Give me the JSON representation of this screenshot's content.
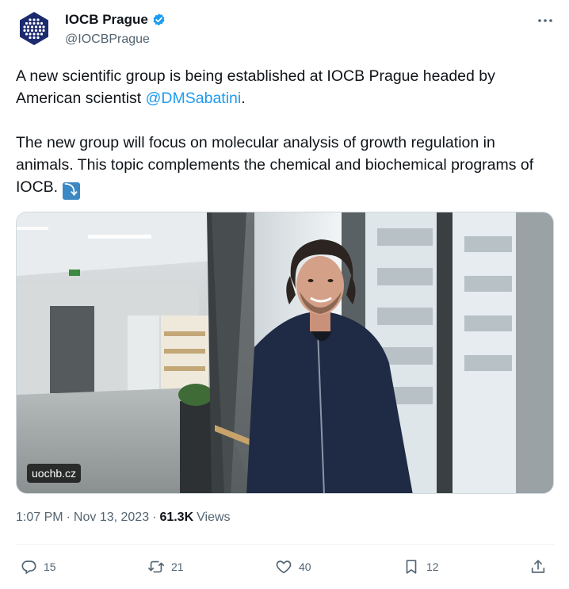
{
  "author": {
    "display_name": "IOCB Prague",
    "handle": "@IOCBPrague",
    "verified": true,
    "avatar_icon": "iocb-logo-icon",
    "avatar_color": "#1c2a6e"
  },
  "tweet": {
    "text_part1": "A new scientific group is being established at IOCB Prague headed by American scientist ",
    "mention": "@DMSabatini",
    "text_part1_end": ".",
    "text_part2": "The new group will focus on molecular analysis of growth regulation in animals. This topic complements the chemical and biochemical programs of IOCB. ",
    "emoji": "⤵"
  },
  "media": {
    "link_label": "uochb.cz"
  },
  "meta": {
    "time": "1:07 PM",
    "separator": "·",
    "date": "Nov 13, 2023",
    "views_count": "61.3K",
    "views_label": "Views"
  },
  "actions": {
    "replies": "15",
    "reposts": "21",
    "likes": "40",
    "bookmarks": "12"
  },
  "colors": {
    "accent": "#1d9bf0",
    "text": "#0f1419",
    "muted": "#536471"
  }
}
